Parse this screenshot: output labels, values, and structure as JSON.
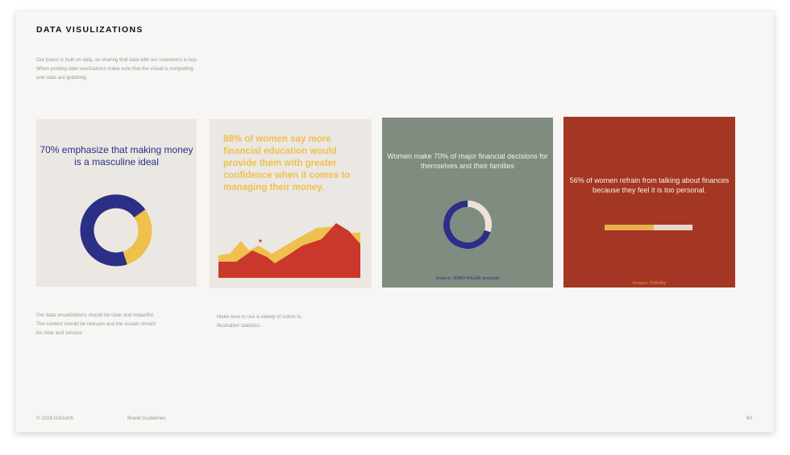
{
  "page": {
    "title": "DATA VISULIZATIONS",
    "intro": "Our brand is built on data, so sharing that data with our customers is key. When posting data visulizations make sure that the visual is compelling and stats are grabbing."
  },
  "cards": [
    {
      "text": "70% emphasize that making money is a masculine ideal",
      "chart_percent": 70,
      "colors": {
        "primary": "#2c2f86",
        "secondary": "#efc04e",
        "background": "#ebe7e3"
      }
    },
    {
      "text": "88% of women say more financial education would provide them with greater confidence when it comes to managing their money.",
      "colors": {
        "text": "#efc04e",
        "front": "#c9382b",
        "back": "#efc04e",
        "background": "#ebe7e3"
      }
    },
    {
      "text": "Women make 70% of major financial decisions for themselves and their families",
      "chart_percent": 70,
      "source": "Source: BMO Wealth Institute",
      "colors": {
        "primary": "#2c2f86",
        "secondary": "#eee2d6",
        "background": "#7f8c7f"
      }
    },
    {
      "text": "56% of women refrain from talking about finances because they feel it is too personal.",
      "chart_percent": 56,
      "source": "Source: Fidelity",
      "colors": {
        "fill": "#e8b04d",
        "track": "#e8d7cf",
        "background": "#a43723"
      }
    }
  ],
  "captions": [
    "Our data visualizations should be clear and impactful. The content should be relevant and the visuals should be clear and consise.",
    "Make sure to use a variety of colors to illustration statistics."
  ],
  "footer": {
    "copyright": "© 2018 GoDutch",
    "section": "Brand Guidelines",
    "page_number": "60"
  }
}
